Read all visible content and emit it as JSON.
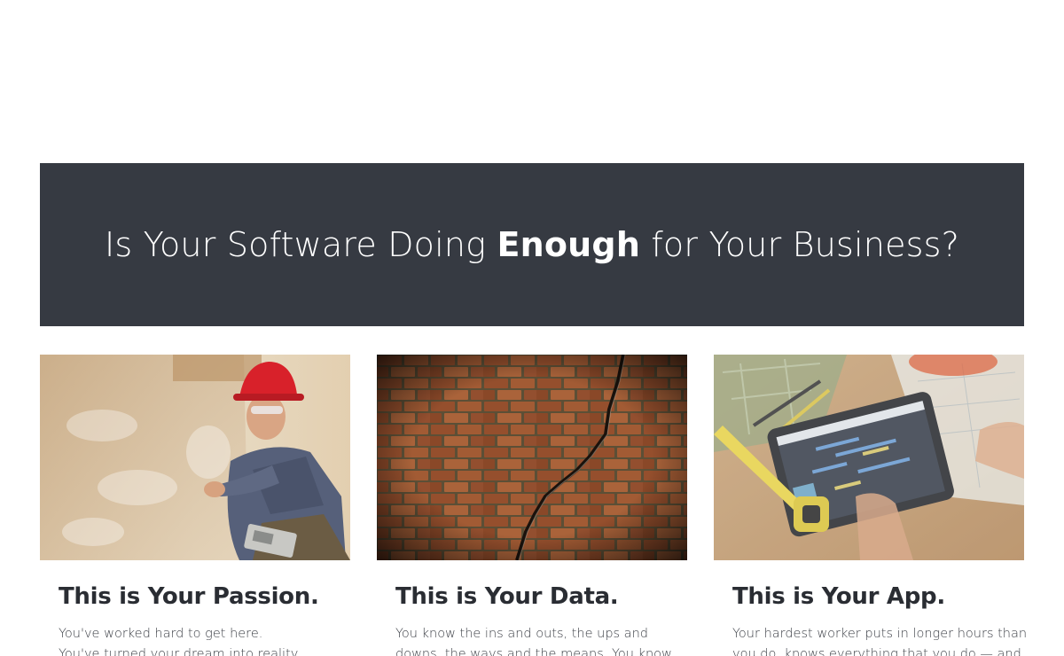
{
  "hero": {
    "title_before": "Is Your Software Doing ",
    "title_emphasis": "Enough",
    "title_after": " for Your Business?",
    "background_color": "#363a42"
  },
  "cards": [
    {
      "image": "construction-inspector-photo",
      "title": "This is Your Passion.",
      "body_lines": [
        "You've worked hard to get here.",
        "You've turned your dream into reality."
      ]
    },
    {
      "image": "cracked-brick-wall-photo",
      "title": "This is Your Data.",
      "body_lines": [
        "You know the ins and outs, the ups and",
        "downs, the ways and the means. You know"
      ]
    },
    {
      "image": "tablet-on-workbench-photo",
      "title": "This is Your App.",
      "body_lines": [
        "Your hardest worker puts in longer hours than",
        "you do, knows everything that you do — and"
      ]
    }
  ]
}
